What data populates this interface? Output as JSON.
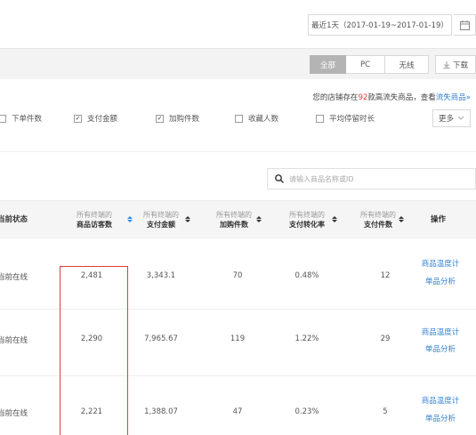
{
  "toolbar": {
    "date_range": "最近1天（2017-01-19~2017-01-19）",
    "calendar_icon": "calendar-icon",
    "segments": [
      {
        "label": "全部",
        "active": true
      },
      {
        "label": "PC",
        "active": false
      },
      {
        "label": "无线",
        "active": false
      }
    ],
    "download_label": "下载",
    "download_icon": "download-icon"
  },
  "notice": {
    "prefix": "您的店铺存在",
    "count": "92",
    "middle": "款高流失商品，查看",
    "link": "流失商品",
    "chevron": "»"
  },
  "metrics": [
    {
      "label": "下单件数",
      "checked": false
    },
    {
      "label": "支付金额",
      "checked": true
    },
    {
      "label": "加购件数",
      "checked": true
    },
    {
      "label": "收藏人数",
      "checked": false
    },
    {
      "label": "平均停留时长",
      "checked": false
    }
  ],
  "more_label": "更多",
  "search": {
    "placeholder": "请输入商品名称或ID"
  },
  "table": {
    "columns": [
      {
        "label": "当前状态"
      },
      {
        "top": "所有终端的",
        "bottom": "商品访客数"
      },
      {
        "top": "所有终端的",
        "bottom": "支付金额"
      },
      {
        "top": "所有终端的",
        "bottom": "加购件数"
      },
      {
        "top": "所有终端的",
        "bottom": "支付转化率"
      },
      {
        "top": "所有终端的",
        "bottom": "支付件数"
      },
      {
        "label": "操作"
      }
    ],
    "rows": [
      {
        "status": "当前在线",
        "visitors": "2,481",
        "payment": "3,343.1",
        "cart": "70",
        "conversion": "0.48%",
        "pieces": "12",
        "action1": "商品温度计",
        "action2": "单品分析"
      },
      {
        "status": "当前在线",
        "visitors": "2,290",
        "payment": "7,965.67",
        "cart": "119",
        "conversion": "1.22%",
        "pieces": "29",
        "action1": "商品温度计",
        "action2": "单品分析"
      },
      {
        "status": "当前在线",
        "visitors": "2,221",
        "payment": "1,388.07",
        "cart": "47",
        "conversion": "0.23%",
        "pieces": "5",
        "action1": "商品温度计",
        "action2": "单品分析"
      }
    ]
  },
  "colors": {
    "accent_blue": "#2f7fd1",
    "highlight_red": "#e4393c",
    "active_segment": "#b4b4b4"
  }
}
